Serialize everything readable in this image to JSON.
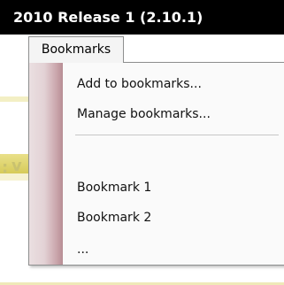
{
  "window": {
    "title": "2010 Release 1 (2.10.1)"
  },
  "menubar": {
    "bookmarks_label": "Bookmarks"
  },
  "bookmarks_menu": {
    "add_label": "Add to bookmarks...",
    "manage_label": "Manage bookmarks...",
    "items": [
      "Bookmark 1",
      "Bookmark 2",
      "..."
    ]
  },
  "colors": {
    "title_bar": "#000000",
    "menu_gutter": "#cba7ad",
    "background_accent": "#d6cb59"
  }
}
